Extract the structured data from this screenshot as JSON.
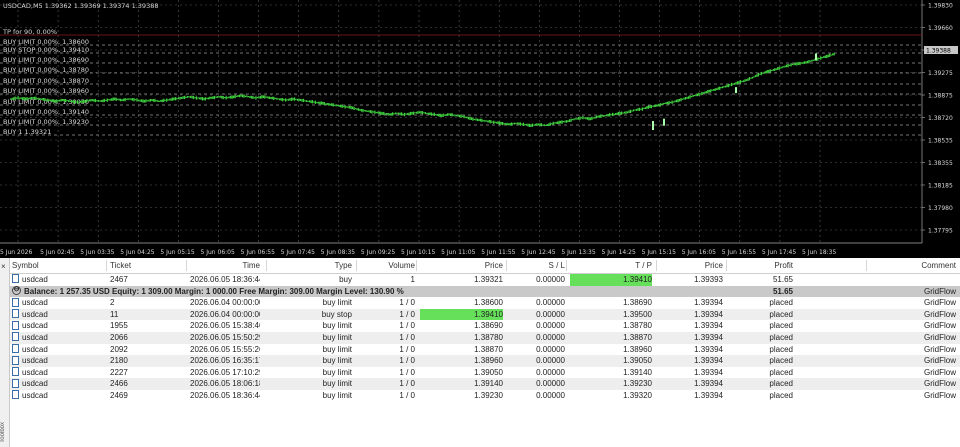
{
  "chart": {
    "title": "USDCAD,M5  1.39362 1.39369 1.39374 1.39388",
    "levels": [
      {
        "label": "TP for 90, 0.00%",
        "line_color": "#8b1a1a",
        "dashed": false
      },
      {
        "label": "BUY LIMIT 0.00%, 1.38600",
        "line_color": "#9a9a9a",
        "dashed": true
      },
      {
        "label": "BUY STOP 0.00%, 1.39410",
        "line_color": "#9a9a9a",
        "dashed": true
      },
      {
        "label": "BUY LIMIT 0.00%, 1.38690",
        "line_color": "#9a9a9a",
        "dashed": true
      },
      {
        "label": "BUY LIMIT 0.00%, 1.38780",
        "line_color": "#9a9a9a",
        "dashed": true
      },
      {
        "label": "BUY LIMIT 0.00%, 1.38870",
        "line_color": "#9a9a9a",
        "dashed": true
      },
      {
        "label": "BUY LIMIT 0.00%, 1.38960",
        "line_color": "#9a9a9a",
        "dashed": true
      },
      {
        "label": "BUY LIMIT 0.00%, 1.39050",
        "line_color": "#9a9a9a",
        "dashed": true
      },
      {
        "label": "BUY LIMIT 0.00%, 1.39140",
        "line_color": "#9a9a9a",
        "dashed": true
      },
      {
        "label": "BUY LIMIT 0.00%, 1.39230",
        "line_color": "#9a9a9a",
        "dashed": true
      },
      {
        "label": "BUY 1 1.39321",
        "line_color": "#9a9a9a",
        "dashed": true
      }
    ],
    "price_ticks": [
      "1.39830",
      "1.39660",
      "1.39490",
      "1.39275",
      "1.38875",
      "1.38720",
      "1.38535",
      "1.38355",
      "1.38185",
      "1.37980",
      "1.37795"
    ],
    "current_price": "1.39388",
    "time_ticks": [
      "5 Jun 2026",
      "5 Jun 02:45",
      "5 Jun 03:35",
      "5 Jun 04:25",
      "5 Jun 05:15",
      "5 Jun 06:05",
      "5 Jun 06:55",
      "5 Jun 07:45",
      "5 Jun 08:35",
      "5 Jun 09:25",
      "5 Jun 10:15",
      "5 Jun 11:05",
      "5 Jun 11:55",
      "5 Jun 12:45",
      "5 Jun 13:35",
      "5 Jun 14:25",
      "5 Jun 15:15",
      "5 Jun 16:05",
      "5 Jun 16:55",
      "5 Jun 17:45",
      "5 Jun 18:35"
    ],
    "colors": {
      "background": "#000000",
      "grid": "#5a5a5a",
      "candle": "#3ed23e",
      "candle_bright": "#aaffaa"
    },
    "price_path": [
      1.3898,
      1.3899,
      1.3898,
      1.3899,
      1.3898,
      1.3897,
      1.3896,
      1.3897,
      1.3896,
      1.3895,
      1.3896,
      1.3897,
      1.3896,
      1.3897,
      1.3898,
      1.3897,
      1.3898,
      1.3897,
      1.3896,
      1.3897,
      1.3896,
      1.3897,
      1.3898,
      1.3899,
      1.39,
      1.3899,
      1.3898,
      1.3899,
      1.39,
      1.3899,
      1.39,
      1.3901,
      1.39,
      1.3899,
      1.39,
      1.3899,
      1.3898,
      1.3897,
      1.3898,
      1.3897,
      1.3896,
      1.3895,
      1.3894,
      1.3893,
      1.3892,
      1.3891,
      1.389,
      1.3888,
      1.3887,
      1.3886,
      1.3885,
      1.3884,
      1.3885,
      1.3884,
      1.3885,
      1.3886,
      1.3885,
      1.3884,
      1.3883,
      1.3884,
      1.3883,
      1.3882,
      1.388,
      1.3879,
      1.3878,
      1.3877,
      1.3876,
      1.3875,
      1.3876,
      1.3875,
      1.3874,
      1.3875,
      1.3874,
      1.3876,
      1.3877,
      1.3878,
      1.388,
      1.3881,
      1.388,
      1.3882,
      1.3883,
      1.3884,
      1.3885,
      1.3886,
      1.3888,
      1.3889,
      1.3891,
      1.3892,
      1.3894,
      1.3895,
      1.3897,
      1.3899,
      1.3901,
      1.3903,
      1.3905,
      1.3907,
      1.3909,
      1.3911,
      1.3913,
      1.3915,
      1.3918,
      1.3921,
      1.3923,
      1.3925,
      1.3927,
      1.3929,
      1.393,
      1.3931,
      1.3933,
      1.3935,
      1.3937,
      1.3939
    ]
  },
  "terminal": {
    "close_label": "×",
    "toolbox_label": "Toolbox",
    "columns": [
      "Symbol",
      "Ticket",
      "Time",
      "Type",
      "Volume",
      "Price",
      "S / L",
      "T / P",
      "Price",
      "Profit",
      "Comment"
    ],
    "position": {
      "symbol": "usdcad",
      "ticket": "2467",
      "time": "2026.06.05 18:36:44",
      "type": "buy",
      "volume": "1",
      "price": "1.39321",
      "sl": "0.00000",
      "tp": "1.39410",
      "cur": "1.39393",
      "profit": "51.65",
      "comment": ""
    },
    "balance": {
      "text": "Balance: 1 257.35 USD  Equity: 1 309.00  Margin: 1 000.00  Free Margin: 309.00  Margin Level: 130.90 %",
      "profit": "51.65",
      "comment": "GridFlow"
    },
    "orders": [
      {
        "symbol": "usdcad",
        "ticket": "2",
        "time": "2026.06.04 00:00:00",
        "type": "buy limit",
        "volume": "1 / 0",
        "price": "1.38600",
        "sl": "0.00000",
        "tp": "1.38690",
        "cur": "1.39394",
        "profit": "placed",
        "comment": "GridFlow",
        "price_highlight": false
      },
      {
        "symbol": "usdcad",
        "ticket": "11",
        "time": "2026.06.04 00:00:00",
        "type": "buy stop",
        "volume": "1 / 0",
        "price": "1.39410",
        "sl": "0.00000",
        "tp": "1.39500",
        "cur": "1.39394",
        "profit": "placed",
        "comment": "GridFlow",
        "price_highlight": true
      },
      {
        "symbol": "usdcad",
        "ticket": "1955",
        "time": "2026.06.05 15:38:46",
        "type": "buy limit",
        "volume": "1 / 0",
        "price": "1.38690",
        "sl": "0.00000",
        "tp": "1.38780",
        "cur": "1.39394",
        "profit": "placed",
        "comment": "GridFlow",
        "price_highlight": false
      },
      {
        "symbol": "usdcad",
        "ticket": "2066",
        "time": "2026.06.05 15:50:29",
        "type": "buy limit",
        "volume": "1 / 0",
        "price": "1.38780",
        "sl": "0.00000",
        "tp": "1.38870",
        "cur": "1.39394",
        "profit": "placed",
        "comment": "GridFlow",
        "price_highlight": false
      },
      {
        "symbol": "usdcad",
        "ticket": "2092",
        "time": "2026.06.05 15:55:26",
        "type": "buy limit",
        "volume": "1 / 0",
        "price": "1.38870",
        "sl": "0.00000",
        "tp": "1.38960",
        "cur": "1.39394",
        "profit": "placed",
        "comment": "GridFlow",
        "price_highlight": false
      },
      {
        "symbol": "usdcad",
        "ticket": "2180",
        "time": "2026.06.05 16:35:17",
        "type": "buy limit",
        "volume": "1 / 0",
        "price": "1.38960",
        "sl": "0.00000",
        "tp": "1.39050",
        "cur": "1.39394",
        "profit": "placed",
        "comment": "GridFlow",
        "price_highlight": false
      },
      {
        "symbol": "usdcad",
        "ticket": "2227",
        "time": "2026.06.05 17:10:29",
        "type": "buy limit",
        "volume": "1 / 0",
        "price": "1.39050",
        "sl": "0.00000",
        "tp": "1.39140",
        "cur": "1.39394",
        "profit": "placed",
        "comment": "GridFlow",
        "price_highlight": false
      },
      {
        "symbol": "usdcad",
        "ticket": "2466",
        "time": "2026.06.05 18:06:18",
        "type": "buy limit",
        "volume": "1 / 0",
        "price": "1.39140",
        "sl": "0.00000",
        "tp": "1.39230",
        "cur": "1.39394",
        "profit": "placed",
        "comment": "GridFlow",
        "price_highlight": false
      },
      {
        "symbol": "usdcad",
        "ticket": "2469",
        "time": "2026.06.05 18:36:44",
        "type": "buy limit",
        "volume": "1 / 0",
        "price": "1.39230",
        "sl": "0.00000",
        "tp": "1.39320",
        "cur": "1.39394",
        "profit": "placed",
        "comment": "GridFlow",
        "price_highlight": false
      }
    ]
  }
}
